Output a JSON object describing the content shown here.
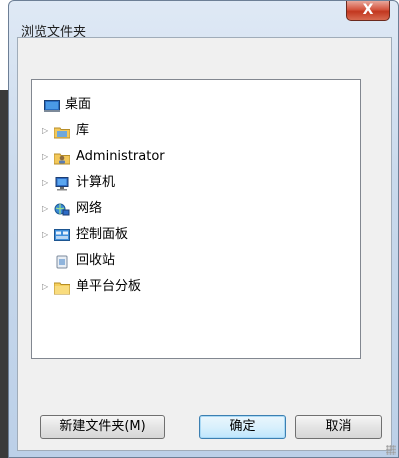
{
  "window": {
    "title": "浏览文件夹",
    "close_label": "X"
  },
  "tree": {
    "items": [
      {
        "label": "桌面",
        "icon": "desktop-icon",
        "expander": "",
        "selected": true
      },
      {
        "label": "库",
        "icon": "library-icon",
        "expander": "▷"
      },
      {
        "label": "Administrator",
        "icon": "user-folder-icon",
        "expander": "▷"
      },
      {
        "label": "计算机",
        "icon": "computer-icon",
        "expander": "▷"
      },
      {
        "label": "网络",
        "icon": "network-icon",
        "expander": "▷"
      },
      {
        "label": "控制面板",
        "icon": "control-panel-icon",
        "expander": "▷"
      },
      {
        "label": "回收站",
        "icon": "recycle-bin-icon",
        "expander": ""
      },
      {
        "label": "单平台分板",
        "icon": "folder-icon",
        "expander": "▷"
      }
    ]
  },
  "buttons": {
    "new_folder": "新建文件夹(M)",
    "ok": "确定",
    "cancel": "取消"
  }
}
